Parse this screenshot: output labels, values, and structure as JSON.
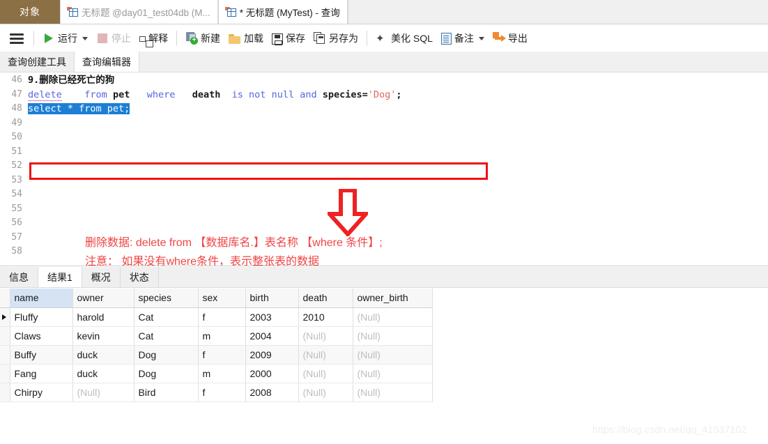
{
  "window": {
    "tabs": [
      {
        "label": "对象",
        "type": "object-pane",
        "active": false
      },
      {
        "label": "无标题 @day01_test04db (M...",
        "type": "query-doc",
        "active": false,
        "icon": "table-icon"
      },
      {
        "label": "* 无标题 (MyTest) - 查询",
        "type": "query-doc",
        "active": true,
        "icon": "table-icon"
      }
    ]
  },
  "toolbar": {
    "menu_icon": "hamburger-icon",
    "items": [
      {
        "label": "运行",
        "icon": "play-icon",
        "dropdown": true,
        "disabled": false
      },
      {
        "label": "停止",
        "icon": "stop-icon",
        "dropdown": false,
        "disabled": true
      },
      {
        "label": "解释",
        "icon": "explain-icon",
        "dropdown": false,
        "disabled": false
      },
      {
        "label": "新建",
        "icon": "new-query-icon",
        "dropdown": false,
        "disabled": false
      },
      {
        "label": "加载",
        "icon": "folder-icon",
        "dropdown": false,
        "disabled": false
      },
      {
        "label": "保存",
        "icon": "save-icon",
        "dropdown": false,
        "disabled": false
      },
      {
        "label": "另存为",
        "icon": "save-as-icon",
        "dropdown": false,
        "disabled": false
      },
      {
        "label": "美化 SQL",
        "icon": "wand-icon",
        "dropdown": false,
        "disabled": false
      },
      {
        "label": "备注",
        "icon": "note-icon",
        "dropdown": true,
        "disabled": false
      },
      {
        "label": "导出",
        "icon": "export-icon",
        "dropdown": false,
        "disabled": false
      }
    ]
  },
  "editor_tabs": [
    {
      "label": "查询创建工具",
      "active": false
    },
    {
      "label": "查询编辑器",
      "active": true
    }
  ],
  "editor": {
    "line_numbers": [
      "46",
      "47",
      "48",
      "49",
      "50",
      "51",
      "52",
      "53",
      "54",
      "55",
      "56",
      "57",
      "58"
    ],
    "lines": [
      {
        "n": "46",
        "tokens": [
          {
            "t": "9.删除已经死亡的狗",
            "c": "cmt"
          }
        ]
      },
      {
        "n": "47",
        "tokens": [
          {
            "t": "delete",
            "c": "kw"
          },
          {
            "t": "    ",
            "c": "plain"
          },
          {
            "t": "from",
            "c": "kw"
          },
          {
            "t": " ",
            "c": "plain"
          },
          {
            "t": "pet",
            "c": "kwb"
          },
          {
            "t": "   ",
            "c": "plain"
          },
          {
            "t": "where",
            "c": "kw"
          },
          {
            "t": "   ",
            "c": "plain"
          },
          {
            "t": "death",
            "c": "kwb"
          },
          {
            "t": "  ",
            "c": "plain"
          },
          {
            "t": "is not null and ",
            "c": "kw"
          },
          {
            "t": "species=",
            "c": "kwb"
          },
          {
            "t": "'Dog'",
            "c": "str"
          },
          {
            "t": ";",
            "c": "kwb"
          }
        ]
      },
      {
        "n": "48",
        "selected_text": "select * from pet;"
      }
    ],
    "highlight_box_color": "#ee1111",
    "selection_color": "#1c7fd4"
  },
  "annotation": {
    "arrow": "down-arrow-red",
    "arrow_color": "#ee2222",
    "text_color": "#f04444",
    "line1": "删除数据: delete  from  【数据库名.】表名称  【where 条件】;",
    "line2": "注意： 如果没有where条件，表示整张表的数据"
  },
  "result_tabs": [
    {
      "label": "信息",
      "active": false
    },
    {
      "label": "结果1",
      "active": true
    },
    {
      "label": "概况",
      "active": false
    },
    {
      "label": "状态",
      "active": false
    }
  ],
  "result_grid": {
    "columns": [
      "name",
      "owner",
      "species",
      "sex",
      "birth",
      "death",
      "owner_birth"
    ],
    "selected_column": "name",
    "null_text": "(Null)",
    "rows": [
      {
        "marker": true,
        "name": "Fluffy",
        "owner": "harold",
        "species": "Cat",
        "sex": "f",
        "birth": "2003",
        "death": "2010",
        "owner_birth": "(Null)"
      },
      {
        "marker": false,
        "name": "Claws",
        "owner": "kevin",
        "species": "Cat",
        "sex": "m",
        "birth": "2004",
        "death": "(Null)",
        "owner_birth": "(Null)"
      },
      {
        "marker": false,
        "name": "Buffy",
        "owner": "duck",
        "species": "Dog",
        "sex": "f",
        "birth": "2009",
        "death": "(Null)",
        "owner_birth": "(Null)"
      },
      {
        "marker": false,
        "name": "Fang",
        "owner": "duck",
        "species": "Dog",
        "sex": "m",
        "birth": "2000",
        "death": "(Null)",
        "owner_birth": "(Null)"
      },
      {
        "marker": false,
        "name": "Chirpy",
        "owner": "(Null)",
        "species": "Bird",
        "sex": "f",
        "birth": "2008",
        "death": "(Null)",
        "owner_birth": "(Null)"
      }
    ]
  },
  "watermark": "https://blog.csdn.net/qq_41537102"
}
